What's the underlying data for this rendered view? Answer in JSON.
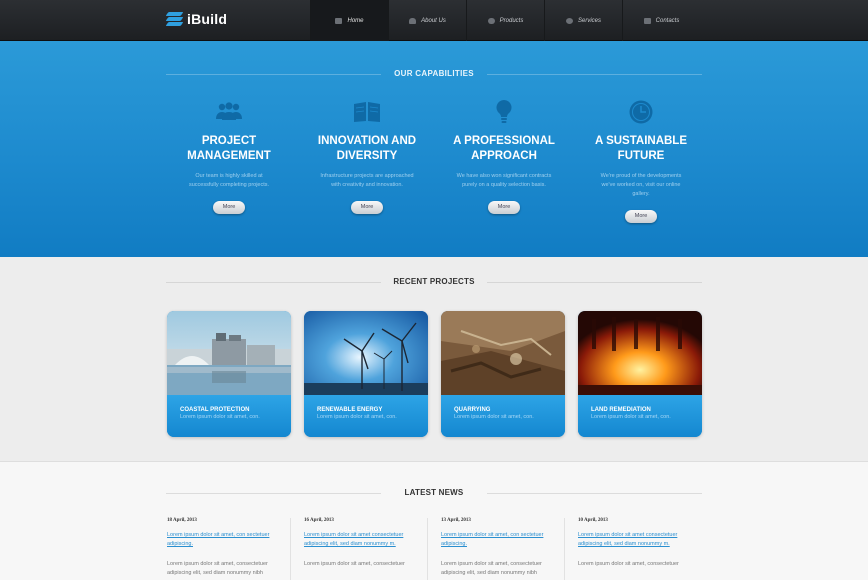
{
  "header": {
    "logo_text": "iBuild",
    "nav": [
      {
        "label": "Home",
        "icon": "home-icon",
        "active": true
      },
      {
        "label": "About Us",
        "icon": "user-icon",
        "active": false
      },
      {
        "label": "Products",
        "icon": "box-icon",
        "active": false
      },
      {
        "label": "Services",
        "icon": "gear-icon",
        "active": false
      },
      {
        "label": "Contacts",
        "icon": "envelope-icon",
        "active": false
      }
    ]
  },
  "capabilities": {
    "title": "OUR CAPABILITIES",
    "items": [
      {
        "icon": "team-icon",
        "heading_1": "PROJECT",
        "heading_2": "MANAGEMENT",
        "desc": "Our team is highly skilled at successfully completing projects.",
        "button": "More"
      },
      {
        "icon": "book-icon",
        "heading_1": "INNOVATION AND",
        "heading_2": "DIVERSITY",
        "desc": "Infrastructure projects are approached with creativity and innovation.",
        "button": "More"
      },
      {
        "icon": "lightbulb-icon",
        "heading_1": "A PROFESSIONAL",
        "heading_2": "APPROACH",
        "desc": "We have also won significant contracts purely on a quality selection basis.",
        "button": "More"
      },
      {
        "icon": "clock-icon",
        "heading_1": "A SUSTAINABLE",
        "heading_2": "FUTURE",
        "desc": "We're proud of the developments we've worked on, visit our online gallery.",
        "button": "More"
      }
    ]
  },
  "projects": {
    "title": "RECENT PROJECTS",
    "items": [
      {
        "name": "COASTAL PROTECTION",
        "desc": "Lorem ipsum dolor sit amet, con."
      },
      {
        "name": "RENEWABLE ENERGY",
        "desc": "Lorem ipsum dolor sit amet, con."
      },
      {
        "name": "QUARRYING",
        "desc": "Lorem ipsum dolor sit amet, con."
      },
      {
        "name": "LAND REMEDIATION",
        "desc": "Lorem ipsum dolor sit amet, con."
      }
    ]
  },
  "news": {
    "title": "LATEST NEWS",
    "items": [
      {
        "date": "18 April, 2013",
        "link": "Lorem ipsum dolor sit amet, con sectetuer adipiscing.",
        "text": "Lorem ipsum dolor sit amet, consectetuer adipiscing elit, sed diam nonummy nibh"
      },
      {
        "date": "16 April, 2013",
        "link": "Lorem ipsum dolor sit amet consectetuer adipiscing elit, sed diam nonummy m.",
        "text": "Lorem ipsum dolor sit amet, consectetuer"
      },
      {
        "date": "13 April, 2013",
        "link": "Lorem ipsum dolor sit amet, con sectetuer adipiscing.",
        "text": "Lorem ipsum dolor sit amet, consectetuer adipiscing elit, sed diam nonummy nibh"
      },
      {
        "date": "10 April, 2013",
        "link": "Lorem ipsum dolor sit amet consectetuer adipiscing elit, sed diam nonummy m.",
        "text": "Lorem ipsum dolor sit amet, consectetuer"
      }
    ]
  },
  "colors": {
    "brand_blue": "#1d8ace",
    "header_dark": "#1d1f22",
    "link_blue": "#2a8fd0"
  }
}
